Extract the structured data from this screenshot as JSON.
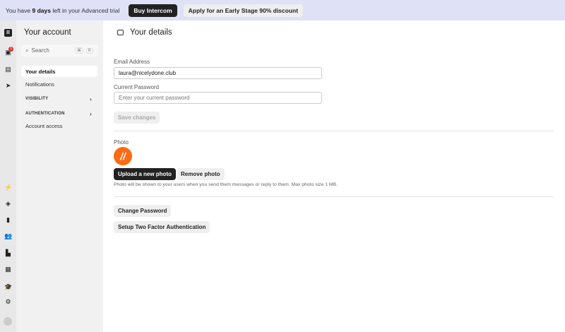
{
  "banner": {
    "prefix": "You have ",
    "days": "9 days",
    "suffix": " left in your Advanced trial",
    "buy": "Buy Intercom",
    "discount": "Apply for an Early Stage 90% discount"
  },
  "rail": {
    "inbox_badge": "1"
  },
  "sidebar": {
    "title": "Your account",
    "search_placeholder": "Search",
    "shortcut_cmd": "⌘",
    "shortcut_key": "K",
    "items": [
      {
        "label": "Your details"
      },
      {
        "label": "Notifications"
      },
      {
        "label": "VISIBILITY"
      },
      {
        "label": "AUTHENTICATION"
      },
      {
        "label": "Account access"
      }
    ]
  },
  "main": {
    "title": "Your details",
    "email_label": "Email Address",
    "email_value": "laura@nicelydone.club",
    "password_label": "Current Password",
    "password_placeholder": "Enter your current password",
    "save": "Save changes",
    "photo_label": "Photo",
    "upload": "Upload a new photo",
    "remove": "Remove photo",
    "photo_help": "Photo will be shown to your users when you send them messages or reply to them. Max photo size 1 MB.",
    "change_password": "Change Password",
    "two_factor": "Setup Two Factor Authentication"
  },
  "colors": {
    "avatar": "#ff6a13",
    "banner": "#dfe1f7"
  }
}
